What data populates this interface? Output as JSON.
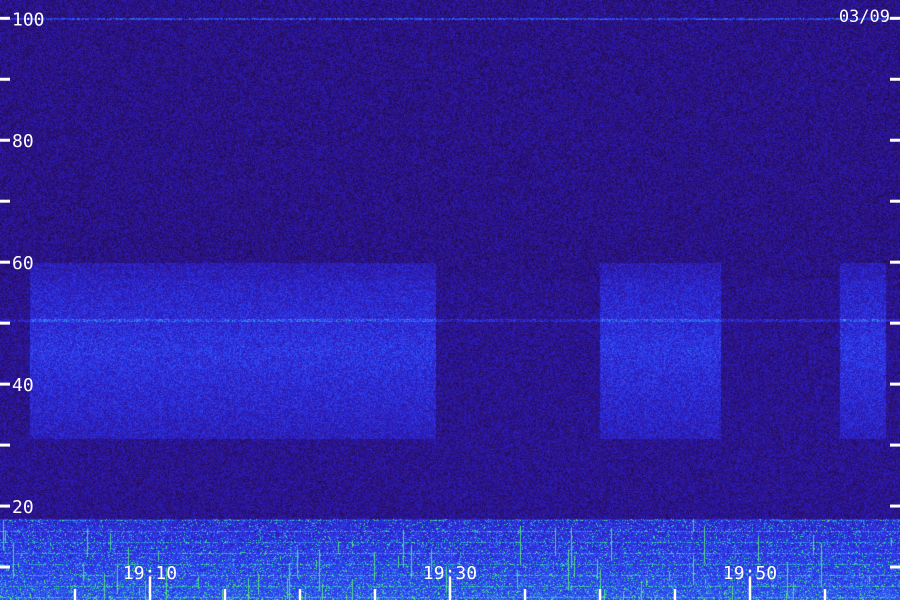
{
  "chart_data": {
    "type": "heatmap",
    "title": "",
    "date_label": "03/09",
    "xlabel": "",
    "ylabel": "",
    "ylim": [
      0,
      103
    ],
    "xlim_minutes": [
      "19:00",
      "19:59"
    ],
    "y_ticks_major": [
      20,
      40,
      60,
      80,
      100
    ],
    "y_tick_labels": [
      "20",
      "40",
      "60",
      "80",
      "100"
    ],
    "y_ticks_minor": [
      10,
      30,
      50,
      70,
      90
    ],
    "x_ticks_major": [
      "19:10",
      "19:30",
      "19:50"
    ],
    "x_tick_labels": [
      "19:10",
      "19:30",
      "19:50"
    ],
    "x_ticks_minor": [
      "19:05",
      "19:15",
      "19:20",
      "19:25",
      "19:35",
      "19:40",
      "19:45",
      "19:55"
    ],
    "colormap": [
      "#0a0418",
      "#2a0f6e",
      "#2d1fc8",
      "#3050ff",
      "#30c8c0",
      "#60f060"
    ],
    "background_level": "low",
    "features": [
      {
        "kind": "narrowband_line",
        "freq": 100,
        "intensity": "medium"
      },
      {
        "kind": "narrowband_line",
        "freq": 50.5,
        "intensity": "low"
      },
      {
        "kind": "band",
        "freq_range": [
          31,
          60
        ],
        "time_range": [
          "19:02",
          "19:29"
        ],
        "intensity": "medium"
      },
      {
        "kind": "band",
        "freq_range": [
          31,
          60
        ],
        "time_range": [
          "19:40",
          "19:48"
        ],
        "intensity": "medium"
      },
      {
        "kind": "band",
        "freq_range": [
          31,
          60
        ],
        "time_range": [
          "19:56",
          "19:59"
        ],
        "intensity": "medium"
      },
      {
        "kind": "low_frequency_noise",
        "freq_range": [
          0,
          18
        ],
        "intensity": "high"
      }
    ]
  }
}
